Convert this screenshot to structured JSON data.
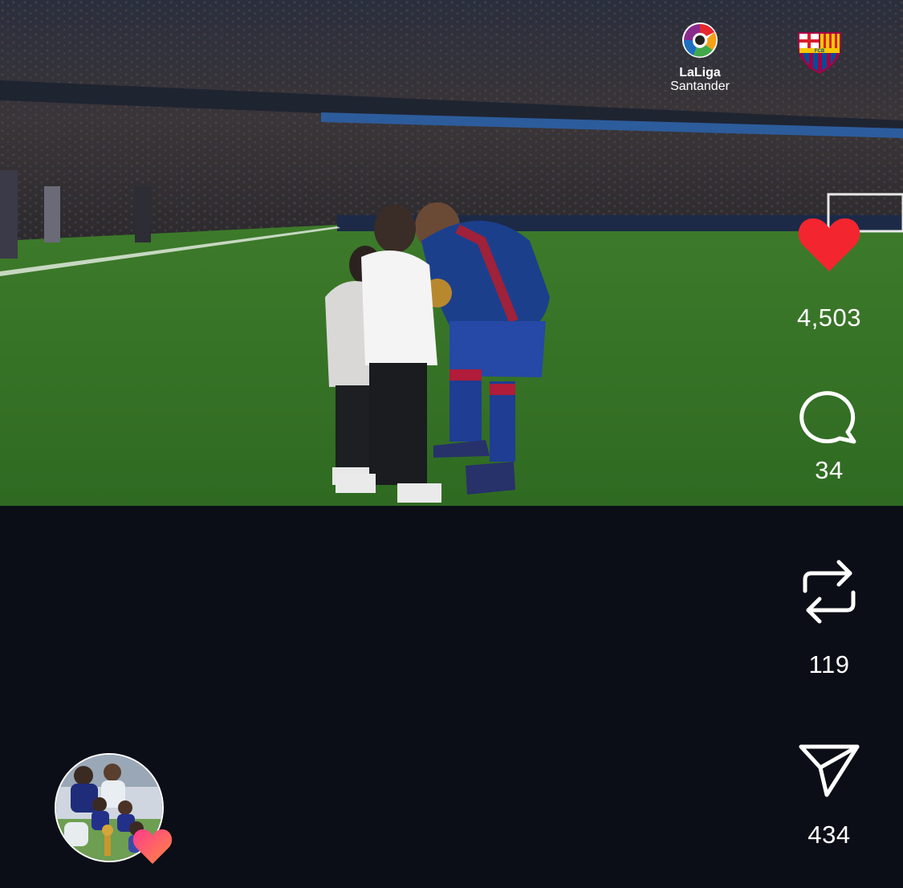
{
  "video": {
    "broadcast_logo": {
      "line1": "LaLiga",
      "line2": "Santander",
      "icon": "laliga-logo"
    },
    "club_crest": {
      "icon": "fc-barcelona-crest",
      "text": "FCB"
    }
  },
  "actions": {
    "like": {
      "icon": "heart-icon",
      "count": "4,503",
      "color": "#f3262f",
      "active": true
    },
    "comment": {
      "icon": "comment-icon",
      "count": "34"
    },
    "repost": {
      "icon": "repost-icon",
      "count": "119"
    },
    "share": {
      "icon": "send-icon",
      "count": "434"
    }
  },
  "author": {
    "avatar_icon": "avatar",
    "badge_icon": "heart-gradient-icon",
    "badge_colors": [
      "#ff3a8f",
      "#ff8a3d"
    ]
  },
  "colors": {
    "background": "#0b0e16",
    "pitch": "#3f7d2c",
    "like": "#f3262f"
  }
}
